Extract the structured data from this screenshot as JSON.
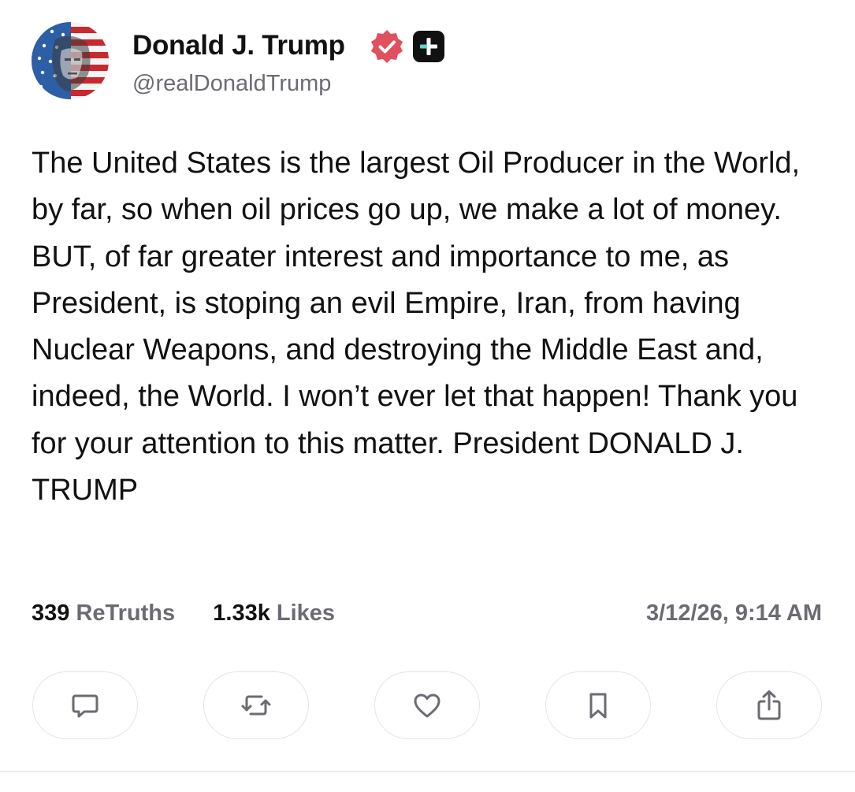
{
  "post": {
    "author": {
      "display_name": "Donald J. Trump",
      "handle": "@realDonaldTrump",
      "verified_icon": "verified-badge-icon",
      "subscription_icon": "plus-badge-icon",
      "avatar_icon": "profile-avatar-flag-portrait"
    },
    "text": "The United States is the largest Oil Producer in the World, by far, so when oil prices go up, we make a lot of money. BUT, of far greater interest and importance to me, as President, is stoping an evil Empire, Iran, from having Nuclear Weapons, and destroying the Middle East and, indeed, the World. I won’t ever let that happen! Thank you for your attention to this matter. President DONALD J. TRUMP",
    "stats": {
      "retruths_count": "339",
      "retruths_label": "ReTruths",
      "likes_count": "1.33k",
      "likes_label": "Likes"
    },
    "timestamp": "3/12/26, 9:14 AM",
    "actions": [
      {
        "name": "reply",
        "icon": "comment-icon"
      },
      {
        "name": "retruth",
        "icon": "repost-icon"
      },
      {
        "name": "like",
        "icon": "heart-icon"
      },
      {
        "name": "bookmark",
        "icon": "bookmark-icon"
      },
      {
        "name": "share",
        "icon": "share-icon"
      }
    ]
  },
  "colors": {
    "text_primary": "#111111",
    "text_secondary": "#6b6b73",
    "verified_badge": "#e0505e",
    "plus_badge": "#111111",
    "button_border": "#e4e4e8",
    "icon": "#6b6b73"
  }
}
